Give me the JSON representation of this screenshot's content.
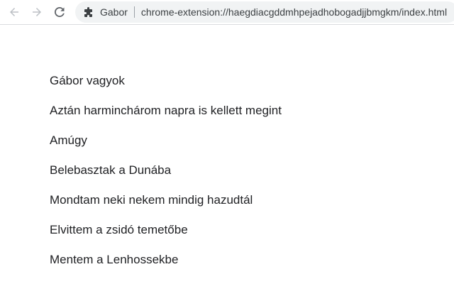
{
  "browser": {
    "back_icon": "arrow-left-icon",
    "forward_icon": "arrow-right-icon",
    "reload_icon": "reload-icon",
    "extension_icon": "puzzle-piece-icon",
    "extension_name": "Gabor",
    "url": "chrome-extension://haegdiacgddmhpejadhobogadjjbmgkm/index.html"
  },
  "content": {
    "lines": [
      "Gábor vagyok",
      "Aztán harminchárom napra is kellett megint",
      "Amúgy",
      "Belebasztak a Dunába",
      "Mondtam neki nekem mindig hazudtál",
      "Elvittem a zsidó temetőbe",
      "Mentem a Lenhossekbe"
    ]
  },
  "colors": {
    "toolbar_bg": "#ffffff",
    "omnibox_bg": "#f1f3f4",
    "icon_gray": "#5f6368",
    "icon_disabled": "#bdc1c6",
    "text": "#202124"
  }
}
